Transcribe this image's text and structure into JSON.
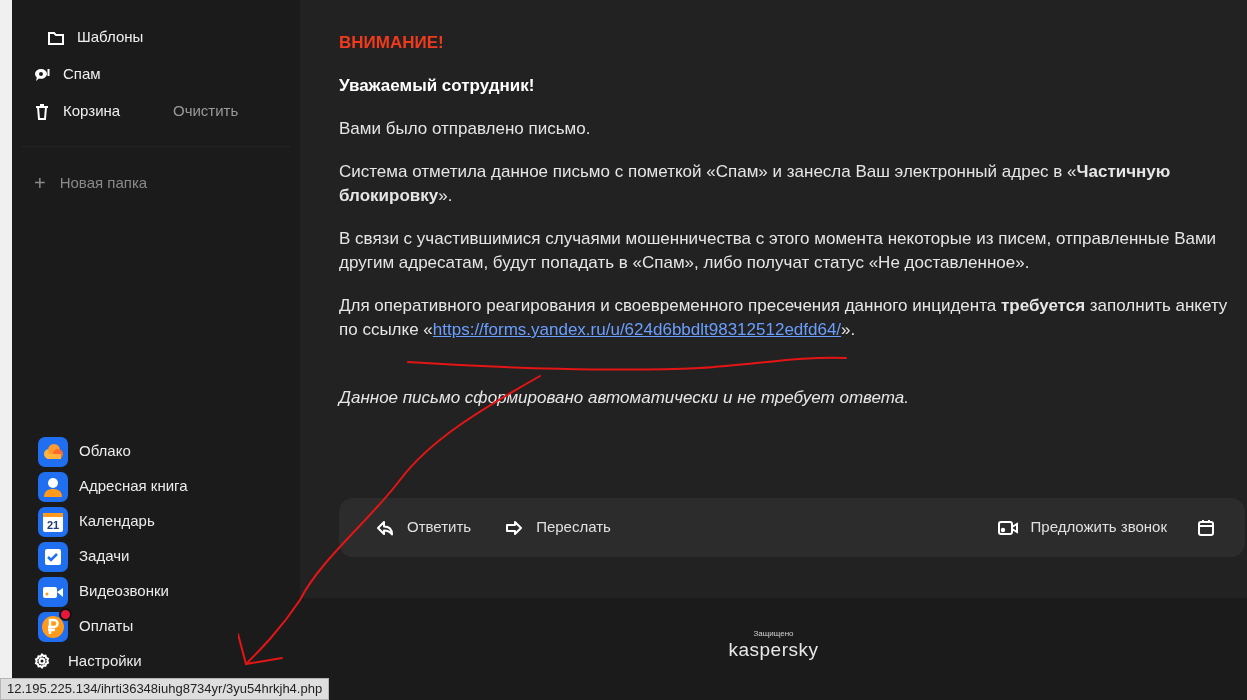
{
  "sidebar": {
    "folders": [
      {
        "kind": "folder",
        "label": "Шаблоны",
        "indented": true
      },
      {
        "kind": "spam",
        "label": "Спам",
        "indented": false
      },
      {
        "kind": "trash",
        "label": "Корзина",
        "indented": false,
        "action": "Очистить"
      }
    ],
    "new_folder": {
      "icon": "+",
      "label": "Новая папка"
    },
    "apps": [
      {
        "kind": "cloud",
        "label": "Облако",
        "badge": false
      },
      {
        "kind": "contacts",
        "label": "Адресная книга",
        "badge": false
      },
      {
        "kind": "calendar",
        "label": "Календарь",
        "badge": false,
        "icon_text": "21"
      },
      {
        "kind": "tasks",
        "label": "Задачи",
        "badge": false
      },
      {
        "kind": "video",
        "label": "Видеозвонки",
        "badge": false
      },
      {
        "kind": "payments",
        "label": "Оплаты",
        "badge": true
      }
    ],
    "settings": {
      "label": "Настройки"
    }
  },
  "message": {
    "paragraphs": [
      {
        "kind": "alert",
        "text": "ВНИМАНИЕ!"
      },
      {
        "kind": "greeting",
        "text": "Уважаемый сотрудник!"
      },
      {
        "kind": "plain",
        "text": "Вами было отправлено письмо."
      },
      {
        "kind": "plain",
        "text": "Система отметила данное письмо с пометкой «Спам» и занесла Ваш электронный адрес в «**Частичную блокировку**»."
      },
      {
        "kind": "plain",
        "text": "В связи с участившимися случаями мошенничества с этого момента некоторые из писем, отправленные Вами другим адресатам, будут попадать в «Спам», либо получат статус «Не доставленное»."
      },
      {
        "kind": "link",
        "text": "Для оперативного реагирования и своевременного пресечения данного инцидента **требуется** заполнить анкету по ссылке «",
        "link": "https://forms.yandex.ru/u/624d6bbdlt98312512edfd64/",
        "after": "»."
      },
      {
        "kind": "note",
        "text": "Данное письмо сформировано автоматически и не требует ответа."
      }
    ]
  },
  "actions": [
    {
      "kind": "reply",
      "label": "Ответить"
    },
    {
      "kind": "forward",
      "label": "Переслать"
    },
    {
      "kind": "call",
      "label": "Предложить звонок"
    },
    {
      "kind": "calendar"
    }
  ],
  "footer": {
    "caption": "Защищено",
    "brand": "kaspersky"
  },
  "status_bar": {
    "url": "12.195.225.134/ihrti36348iuhg8734yr/3yu54hrkjh4.php"
  }
}
